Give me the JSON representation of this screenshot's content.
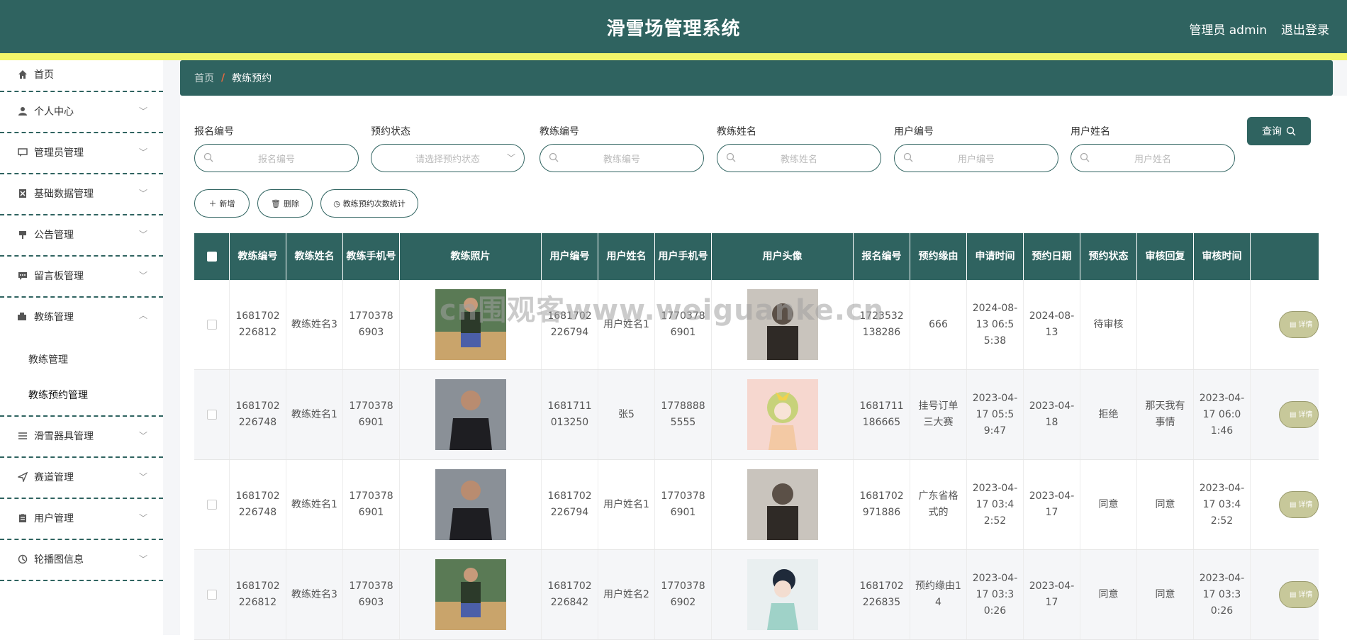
{
  "header": {
    "title": "滑雪场管理系统",
    "user": "管理员 admin",
    "logout": "退出登录",
    "colors": {
      "primary": "#2f6360",
      "accent_bar": "#f2f56a"
    }
  },
  "sidebar": {
    "items": [
      {
        "label": "首页",
        "icon": "home-icon"
      },
      {
        "label": "个人中心",
        "icon": "user-icon"
      },
      {
        "label": "管理员管理",
        "icon": "chat-icon"
      },
      {
        "label": "基础数据管理",
        "icon": "data-icon"
      },
      {
        "label": "公告管理",
        "icon": "notice-icon"
      },
      {
        "label": "留言板管理",
        "icon": "message-icon"
      },
      {
        "label": "教练管理",
        "icon": "coach-icon"
      },
      {
        "label": "滑雪器具管理",
        "icon": "list-icon"
      },
      {
        "label": "赛道管理",
        "icon": "send-icon"
      },
      {
        "label": "用户管理",
        "icon": "clipboard-icon"
      },
      {
        "label": "轮播图信息",
        "icon": "carousel-icon"
      }
    ],
    "submenu": [
      "教练管理",
      "教练预约管理"
    ]
  },
  "breadcrumb": {
    "home": "首页",
    "sep": "/",
    "current": "教练预约"
  },
  "filters": [
    {
      "label": "报名编号",
      "placeholder": "报名编号"
    },
    {
      "label": "预约状态",
      "placeholder": "请选择预约状态"
    },
    {
      "label": "教练编号",
      "placeholder": "教练编号"
    },
    {
      "label": "教练姓名",
      "placeholder": "教练姓名"
    },
    {
      "label": "用户编号",
      "placeholder": "用户编号"
    },
    {
      "label": "用户姓名",
      "placeholder": "用户姓名"
    }
  ],
  "buttons": {
    "query": "查询",
    "add": "新增",
    "delete": "删除",
    "stats": "教练预约次数统计",
    "detail": "详情"
  },
  "table": {
    "headers": [
      "教练编号",
      "教练姓名",
      "教练手机号",
      "教练照片",
      "用户编号",
      "用户姓名",
      "用户手机号",
      "用户头像",
      "报名编号",
      "预约缘由",
      "申请时间",
      "预约日期",
      "预约状态",
      "审核回复",
      "审核时间"
    ],
    "rows": [
      {
        "coach_no": "1681702226812",
        "coach_name": "教练姓名3",
        "coach_phone": "17703786903",
        "user_no": "1681702226794",
        "user_name": "用户姓名1",
        "user_phone": "17703786901",
        "signup_no": "1723532138286",
        "reason": "666",
        "apply_time": "2024-08-13 06:55:38",
        "date": "2024-08-13",
        "status": "待审核",
        "reply": "",
        "review_time": ""
      },
      {
        "coach_no": "1681702226748",
        "coach_name": "教练姓名1",
        "coach_phone": "17703786901",
        "user_no": "1681711013250",
        "user_name": "张5",
        "user_phone": "17788885555",
        "signup_no": "1681711186665",
        "reason": "挂号订单三大赛",
        "apply_time": "2023-04-17 05:59:47",
        "date": "2023-04-18",
        "status": "拒绝",
        "reply": "那天我有事情",
        "review_time": "2023-04-17 06:01:46"
      },
      {
        "coach_no": "1681702226748",
        "coach_name": "教练姓名1",
        "coach_phone": "17703786901",
        "user_no": "1681702226794",
        "user_name": "用户姓名1",
        "user_phone": "17703786901",
        "signup_no": "1681702971886",
        "reason": "广东省格式的",
        "apply_time": "2023-04-17 03:42:52",
        "date": "2023-04-17",
        "status": "同意",
        "reply": "同意",
        "review_time": "2023-04-17 03:42:52"
      },
      {
        "coach_no": "1681702226812",
        "coach_name": "教练姓名3",
        "coach_phone": "17703786903",
        "user_no": "1681702226842",
        "user_name": "用户姓名2",
        "user_phone": "17703786902",
        "signup_no": "1681702226835",
        "reason": "预约缘由14",
        "apply_time": "2023-04-17 03:30:26",
        "date": "2023-04-17",
        "status": "同意",
        "reply": "同意",
        "review_time": "2023-04-17 03:30:26"
      }
    ]
  },
  "watermark": "cn围观客www.weiguanke.cn"
}
